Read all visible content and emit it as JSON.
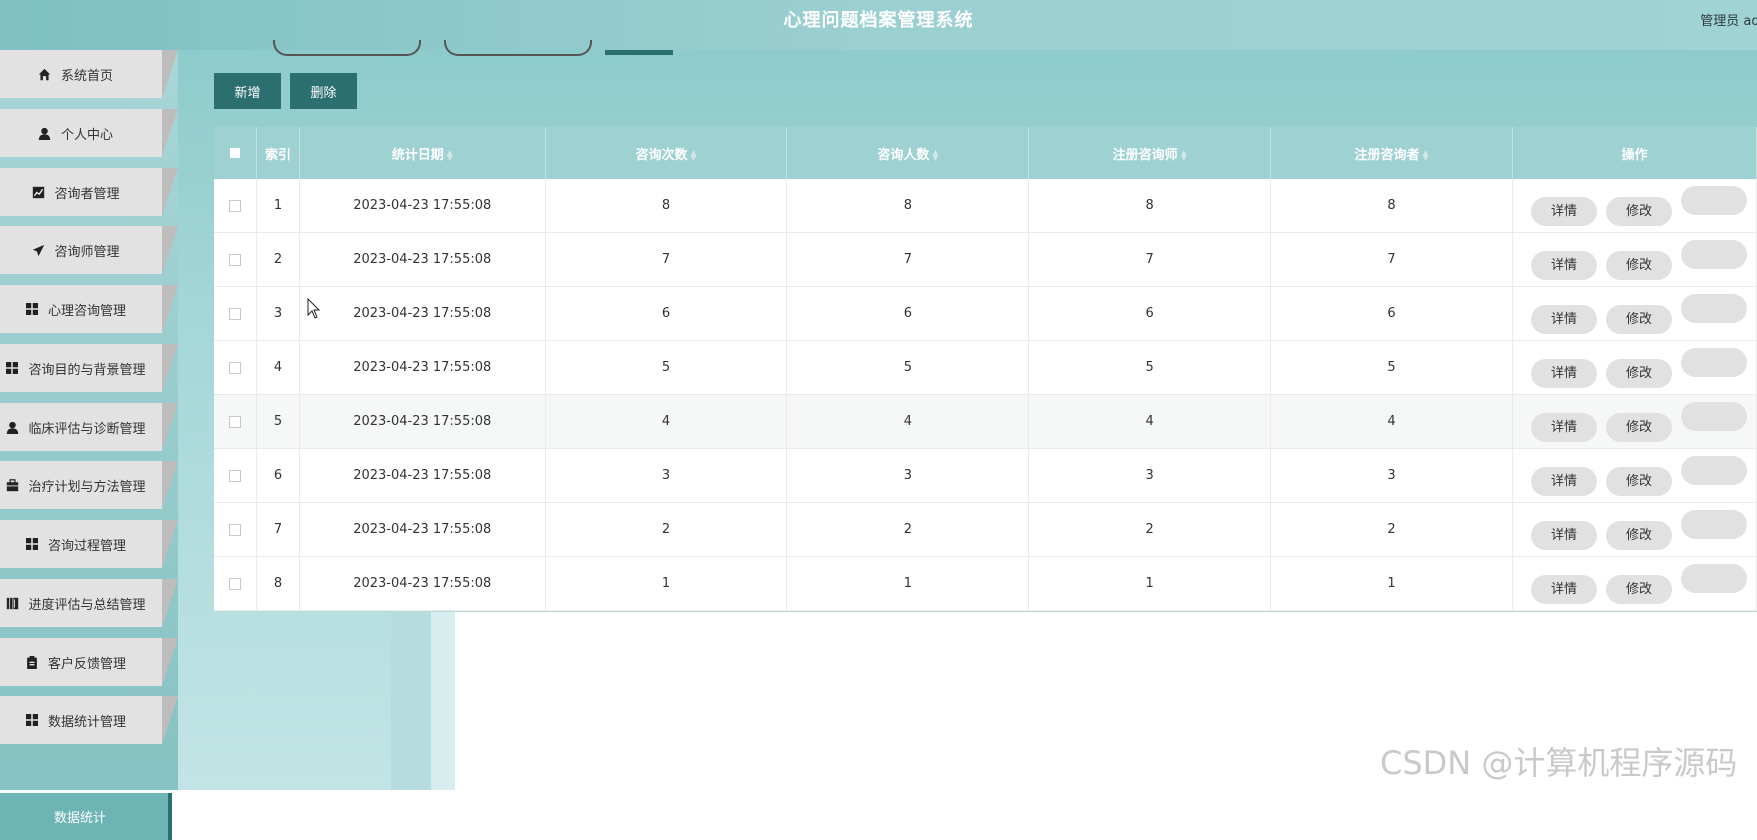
{
  "header": {
    "title": "心理问题档案管理系统",
    "user": "管理员 adr"
  },
  "sidebar": {
    "items": [
      {
        "label": "系统首页",
        "icon": "home-icon"
      },
      {
        "label": "个人中心",
        "icon": "user-icon"
      },
      {
        "label": "咨询者管理",
        "icon": "chart-icon"
      },
      {
        "label": "咨询师管理",
        "icon": "send-icon"
      },
      {
        "label": "心理咨询管理",
        "icon": "grid-icon"
      },
      {
        "label": "咨询目的与背景管理",
        "icon": "grid-icon"
      },
      {
        "label": "临床评估与诊断管理",
        "icon": "user-icon"
      },
      {
        "label": "治疗计划与方法管理",
        "icon": "briefcase-icon"
      },
      {
        "label": "咨询过程管理",
        "icon": "grid-icon"
      },
      {
        "label": "进度评估与总结管理",
        "icon": "book-icon"
      },
      {
        "label": "客户反馈管理",
        "icon": "clipboard-icon"
      },
      {
        "label": "数据统计管理",
        "icon": "grid-icon"
      }
    ],
    "active": "数据统计"
  },
  "toolbar": {
    "add_label": "新增",
    "delete_label": "删除"
  },
  "table": {
    "columns": [
      "索引",
      "统计日期",
      "咨询次数",
      "咨询人数",
      "注册咨询师",
      "注册咨询者",
      "操作"
    ],
    "rows": [
      {
        "index": "1",
        "date": "2023-04-23 17:55:08",
        "consult_count": "8",
        "consult_people": "8",
        "counselors": "8",
        "clients": "8"
      },
      {
        "index": "2",
        "date": "2023-04-23 17:55:08",
        "consult_count": "7",
        "consult_people": "7",
        "counselors": "7",
        "clients": "7"
      },
      {
        "index": "3",
        "date": "2023-04-23 17:55:08",
        "consult_count": "6",
        "consult_people": "6",
        "counselors": "6",
        "clients": "6"
      },
      {
        "index": "4",
        "date": "2023-04-23 17:55:08",
        "consult_count": "5",
        "consult_people": "5",
        "counselors": "5",
        "clients": "5"
      },
      {
        "index": "5",
        "date": "2023-04-23 17:55:08",
        "consult_count": "4",
        "consult_people": "4",
        "counselors": "4",
        "clients": "4"
      },
      {
        "index": "6",
        "date": "2023-04-23 17:55:08",
        "consult_count": "3",
        "consult_people": "3",
        "counselors": "3",
        "clients": "3"
      },
      {
        "index": "7",
        "date": "2023-04-23 17:55:08",
        "consult_count": "2",
        "consult_people": "2",
        "counselors": "2",
        "clients": "2"
      },
      {
        "index": "8",
        "date": "2023-04-23 17:55:08",
        "consult_count": "1",
        "consult_people": "1",
        "counselors": "1",
        "clients": "1"
      }
    ],
    "row_actions": {
      "detail": "详情",
      "edit": "修改"
    }
  },
  "watermark": "CSDN @计算机程序源码",
  "colors": {
    "header": "#9bd0d2",
    "dark_button": "#2b6f70",
    "table_header": "#9dd1d2",
    "sidebar_item": "#e2e2e2"
  }
}
